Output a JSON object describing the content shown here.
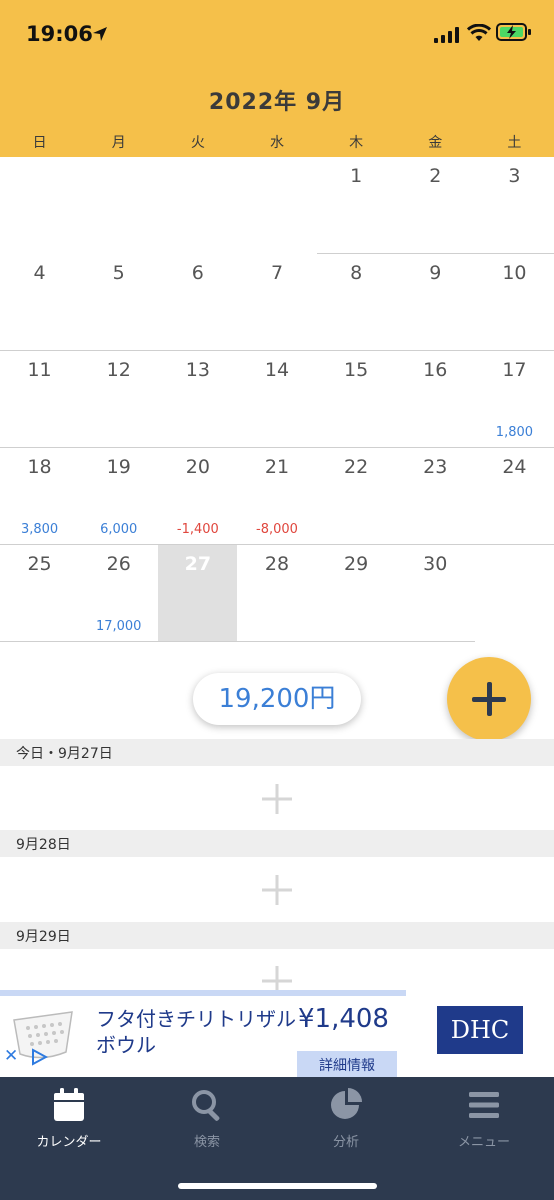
{
  "status": {
    "time": "19:06"
  },
  "header": {
    "month_title": "2022年 9月",
    "weekdays": [
      "日",
      "月",
      "火",
      "水",
      "木",
      "金",
      "土"
    ]
  },
  "calendar": {
    "weeks": [
      [
        null,
        null,
        null,
        null,
        {
          "day": "1"
        },
        {
          "day": "2"
        },
        {
          "day": "3"
        }
      ],
      [
        {
          "day": "4"
        },
        {
          "day": "5"
        },
        {
          "day": "6"
        },
        {
          "day": "7"
        },
        {
          "day": "8"
        },
        {
          "day": "9"
        },
        {
          "day": "10"
        }
      ],
      [
        {
          "day": "11"
        },
        {
          "day": "12"
        },
        {
          "day": "13"
        },
        {
          "day": "14"
        },
        {
          "day": "15"
        },
        {
          "day": "16"
        },
        {
          "day": "17",
          "amount": "1,800",
          "sign": "pos"
        }
      ],
      [
        {
          "day": "18",
          "amount": "3,800",
          "sign": "pos"
        },
        {
          "day": "19",
          "amount": "6,000",
          "sign": "pos"
        },
        {
          "day": "20",
          "amount": "-1,400",
          "sign": "neg"
        },
        {
          "day": "21",
          "amount": "-8,000",
          "sign": "neg"
        },
        {
          "day": "22"
        },
        {
          "day": "23"
        },
        {
          "day": "24"
        }
      ],
      [
        {
          "day": "25"
        },
        {
          "day": "26",
          "amount": "17,000",
          "sign": "pos"
        },
        {
          "day": "27",
          "today": true
        },
        {
          "day": "28"
        },
        {
          "day": "29"
        },
        {
          "day": "30"
        },
        null
      ]
    ]
  },
  "summary": {
    "total": "19,200円"
  },
  "days": [
    {
      "label": "今日・9月27日"
    },
    {
      "label": "9月28日"
    },
    {
      "label": "9月29日"
    }
  ],
  "ad": {
    "product": "フタ付きチリトリザルボウル",
    "price": "¥1,408",
    "detail_button": "詳細情報",
    "brand_logo": "DHC",
    "close": "✕"
  },
  "tabs": [
    {
      "label": "カレンダー",
      "icon": "calendar-icon",
      "active": true
    },
    {
      "label": "検索",
      "icon": "search-icon",
      "active": false
    },
    {
      "label": "分析",
      "icon": "pie-chart-icon",
      "active": false
    },
    {
      "label": "メニュー",
      "icon": "menu-icon",
      "active": false
    }
  ],
  "colors": {
    "accent": "#f5c04a",
    "positive": "#3b7fd6",
    "negative": "#e0473e",
    "tabbar": "#2d3a4f"
  }
}
